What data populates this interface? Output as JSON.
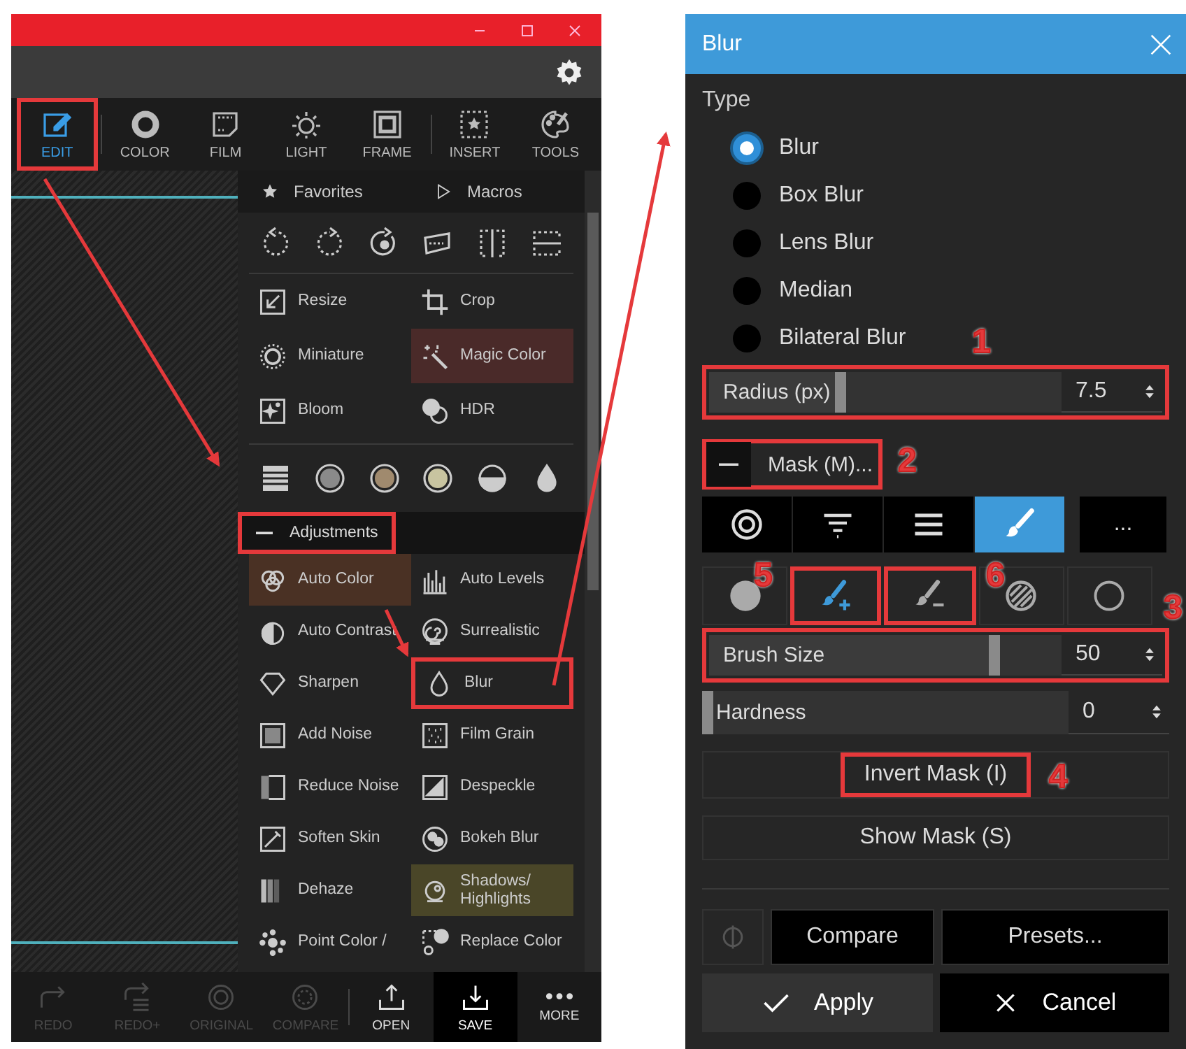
{
  "editor_window": {
    "nav": [
      {
        "label": "EDIT",
        "selected": true,
        "annotated": true
      },
      {
        "label": "COLOR",
        "selected": false,
        "annotated": false
      },
      {
        "label": "FILM",
        "selected": false,
        "annotated": false
      },
      {
        "label": "LIGHT",
        "selected": false,
        "annotated": false
      },
      {
        "label": "FRAME",
        "selected": false,
        "annotated": false
      },
      {
        "label": "INSERT",
        "selected": false,
        "annotated": false
      },
      {
        "label": "TOOLS",
        "selected": false,
        "annotated": false
      }
    ],
    "panel_tabs": [
      "Favorites",
      "Macros"
    ],
    "tools": [
      {
        "label": "Resize"
      },
      {
        "label": "Crop"
      },
      {
        "label": "Miniature"
      },
      {
        "label": "Magic Color",
        "color": "#4a2a29"
      },
      {
        "label": "Bloom"
      },
      {
        "label": "HDR"
      }
    ],
    "adjustments_header": {
      "label": "Adjustments",
      "expanded": true,
      "annotated": true
    },
    "adjustments": [
      {
        "label": "Auto Color",
        "color": "#4a3124"
      },
      {
        "label": "Auto Levels"
      },
      {
        "label": "Auto Contrast"
      },
      {
        "label": "Surrealistic"
      },
      {
        "label": "Sharpen"
      },
      {
        "label": "Blur",
        "annotated": true
      },
      {
        "label": "Add Noise"
      },
      {
        "label": "Film Grain"
      },
      {
        "label": "Reduce Noise"
      },
      {
        "label": "Despeckle"
      },
      {
        "label": "Soften Skin"
      },
      {
        "label": "Bokeh Blur"
      },
      {
        "label": "Dehaze"
      },
      {
        "label": "Shadows/ Highlights",
        "color": "#4a4628"
      },
      {
        "label": "Point Color /"
      },
      {
        "label": "Replace Color"
      }
    ],
    "bottom_bar": [
      {
        "label": "REDO",
        "disabled": true,
        "selected": false
      },
      {
        "label": "REDO+",
        "disabled": true,
        "selected": false
      },
      {
        "label": "ORIGINAL",
        "disabled": true,
        "selected": false
      },
      {
        "label": "COMPARE",
        "disabled": true,
        "selected": false
      },
      {
        "label": "OPEN",
        "disabled": false,
        "selected": false
      },
      {
        "label": "SAVE",
        "disabled": false,
        "selected": true
      },
      {
        "label": "MORE",
        "disabled": false,
        "selected": false
      }
    ]
  },
  "blur_dialog": {
    "title": "Blur",
    "type_label": "Type",
    "types": [
      {
        "label": "Blur",
        "selected": true
      },
      {
        "label": "Box Blur",
        "selected": false
      },
      {
        "label": "Lens Blur",
        "selected": false
      },
      {
        "label": "Median",
        "selected": false
      },
      {
        "label": "Bilateral Blur",
        "selected": false
      }
    ],
    "radius": {
      "label": "Radius (px)",
      "value": "7.5",
      "level": 0.37,
      "annotated": true,
      "callout": "1"
    },
    "mask": {
      "label": "Mask (M)...",
      "expanded": true,
      "annotated": true,
      "callout": "2"
    },
    "mask_modes": [
      {
        "selected": false
      },
      {
        "selected": false
      },
      {
        "selected": false
      },
      {
        "selected": true
      },
      {
        "label": "...",
        "selected": false
      }
    ],
    "brush_tools": {
      "callout": "3",
      "items": [
        {
          "selected": false,
          "annotated": false
        },
        {
          "selected": true,
          "annotated": true,
          "callout": "5"
        },
        {
          "selected": false,
          "annotated": true,
          "callout": "6"
        },
        {
          "selected": false,
          "annotated": false
        },
        {
          "selected": false,
          "annotated": false
        }
      ]
    },
    "brush_size": {
      "label": "Brush Size",
      "value": "50",
      "level": 0.82,
      "annotated": true
    },
    "hardness": {
      "label": "Hardness",
      "value": "0",
      "level": 0
    },
    "invert_button": {
      "label": "Invert Mask (I)",
      "annotated": true,
      "callout": "4"
    },
    "show_mask_button": {
      "label": "Show Mask (S)"
    },
    "compare_button": "Compare",
    "presets_button": "Presets...",
    "apply_button": "Apply",
    "cancel_button": "Cancel"
  }
}
